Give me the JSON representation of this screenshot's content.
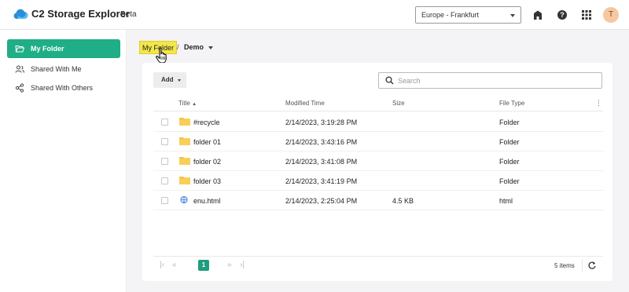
{
  "header": {
    "app_title": "C2 Storage Explorer",
    "badge": "Beta",
    "region": "Europe - Frankfurt",
    "user_initial": "T",
    "icons": [
      "cloud-logo-icon",
      "home-icon",
      "help-icon",
      "apps-grid-icon"
    ]
  },
  "sidebar": {
    "items": [
      {
        "label": "My Folder",
        "icon": "folder-open-icon",
        "active": true
      },
      {
        "label": "Shared With Me",
        "icon": "users-icon",
        "active": false
      },
      {
        "label": "Shared With Others",
        "icon": "share-icon",
        "active": false
      }
    ]
  },
  "breadcrumb": {
    "root": "My Folder",
    "separator": "/",
    "current": "Demo"
  },
  "toolbar": {
    "add_label": "Add",
    "search_placeholder": "Search"
  },
  "table": {
    "headers": {
      "title": "Title",
      "modified": "Modified Time",
      "size": "Size",
      "type": "File Type"
    },
    "rows": [
      {
        "icon": "folder-icon",
        "name": "#recycle",
        "modified": "2/14/2023, 3:19:28 PM",
        "size": "",
        "type": "Folder"
      },
      {
        "icon": "folder-icon",
        "name": "folder 01",
        "modified": "2/14/2023, 3:43:16 PM",
        "size": "",
        "type": "Folder"
      },
      {
        "icon": "folder-icon",
        "name": "folder 02",
        "modified": "2/14/2023, 3:41:08 PM",
        "size": "",
        "type": "Folder"
      },
      {
        "icon": "folder-icon",
        "name": "folder 03",
        "modified": "2/14/2023, 3:41:19 PM",
        "size": "",
        "type": "Folder"
      },
      {
        "icon": "html-file-icon",
        "name": "enu.html",
        "modified": "2/14/2023, 2:25:04 PM",
        "size": "4.5 KB",
        "type": "html"
      }
    ]
  },
  "pagination": {
    "current_page": "1",
    "total_items": "5 items"
  },
  "colors": {
    "accent": "#1fae86",
    "highlight": "#f3e64a",
    "folder": "#f5c242"
  }
}
